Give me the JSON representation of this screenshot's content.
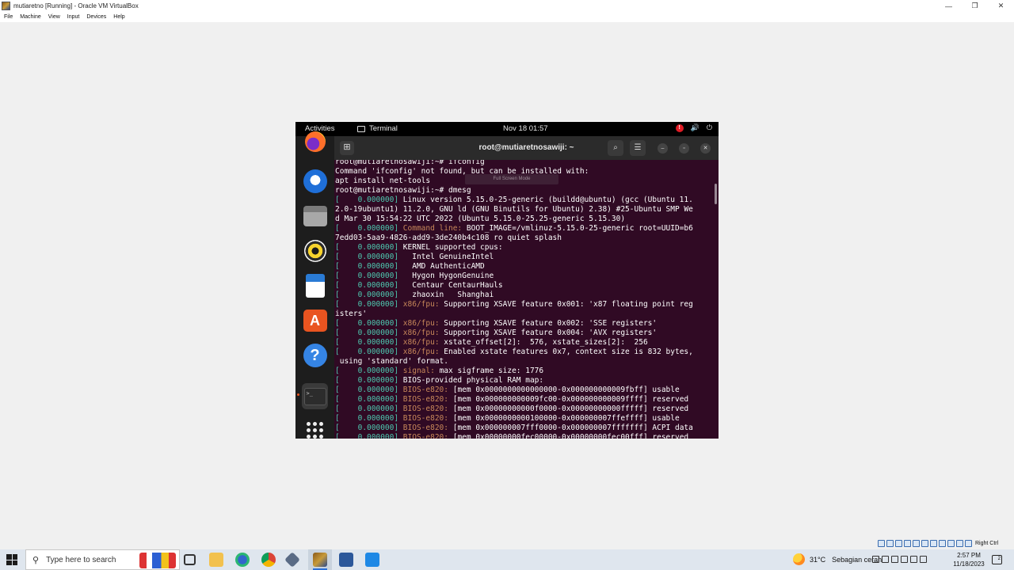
{
  "host": {
    "window_title": "mutiaretno [Running] - Oracle VM VirtualBox",
    "controls": {
      "minimize": "—",
      "restore": "❐",
      "close": "✕"
    },
    "menu": [
      "File",
      "Machine",
      "View",
      "Input",
      "Devices",
      "Help"
    ],
    "host_key": "Right Ctrl"
  },
  "guest": {
    "topbar": {
      "activities": "Activities",
      "app_name": "Terminal",
      "clock": "Nov 18  01:57",
      "alert": "!",
      "volume": "🔊",
      "power": "⏻"
    },
    "terminal": {
      "title": "root@mutiaretnosawiji: ~",
      "newtab": "⊞",
      "search": "⌕",
      "menu": "☰",
      "minimize": "–",
      "maximize": "▫",
      "close": "✕",
      "overlay_hint": "Full Screen Mode",
      "lines": [
        {
          "text": "root@mutiaretnosawiji:~# ifconfig"
        },
        {
          "text": "Command 'ifconfig' not found, but can be installed with:"
        },
        {
          "text": "apt install net-tools"
        },
        {
          "text": "root@mutiaretnosawiji:~# dmesg"
        },
        {
          "ts": "[    0.000000]",
          "text": " Linux version 5.15.0-25-generic (buildd@ubuntu) (gcc (Ubuntu 11."
        },
        {
          "text": "2.0-19ubuntu1) 11.2.0, GNU ld (GNU Binutils for Ubuntu) 2.38) #25-Ubuntu SMP We"
        },
        {
          "text": "d Mar 30 15:54:22 UTC 2022 (Ubuntu 5.15.0-25.25-generic 5.15.30)"
        },
        {
          "ts": "[    0.000000]",
          "sub": " Command line:",
          "text": " BOOT_IMAGE=/vmlinuz-5.15.0-25-generic root=UUID=b6"
        },
        {
          "text": "7edd03-5aa9-4826-add9-3de240b4c108 ro quiet splash"
        },
        {
          "ts": "[    0.000000]",
          "text": " KERNEL supported cpus:"
        },
        {
          "ts": "[    0.000000]",
          "text": "   Intel GenuineIntel"
        },
        {
          "ts": "[    0.000000]",
          "text": "   AMD AuthenticAMD"
        },
        {
          "ts": "[    0.000000]",
          "text": "   Hygon HygonGenuine"
        },
        {
          "ts": "[    0.000000]",
          "text": "   Centaur CentaurHauls"
        },
        {
          "ts": "[    0.000000]",
          "text": "   zhaoxin   Shanghai"
        },
        {
          "ts": "[    0.000000]",
          "sub": " x86/fpu:",
          "text": " Supporting XSAVE feature 0x001: 'x87 floating point reg"
        },
        {
          "text": "isters'"
        },
        {
          "ts": "[    0.000000]",
          "sub": " x86/fpu:",
          "text": " Supporting XSAVE feature 0x002: 'SSE registers'"
        },
        {
          "ts": "[    0.000000]",
          "sub": " x86/fpu:",
          "text": " Supporting XSAVE feature 0x004: 'AVX registers'"
        },
        {
          "ts": "[    0.000000]",
          "sub": " x86/fpu:",
          "text": " xstate_offset[2]:  576, xstate_sizes[2]:  256"
        },
        {
          "ts": "[    0.000000]",
          "sub": " x86/fpu:",
          "text": " Enabled xstate features 0x7, context size is 832 bytes,"
        },
        {
          "text": " using 'standard' format."
        },
        {
          "ts": "[    0.000000]",
          "sub": " signal:",
          "text": " max sigframe size: 1776"
        },
        {
          "ts": "[    0.000000]",
          "text": " BIOS-provided physical RAM map:"
        },
        {
          "ts": "[    0.000000]",
          "sub": " BIOS-e820:",
          "text": " [mem 0x0000000000000000-0x000000000009fbff] usable"
        },
        {
          "ts": "[    0.000000]",
          "sub": " BIOS-e820:",
          "text": " [mem 0x000000000009fc00-0x000000000009ffff] reserved"
        },
        {
          "ts": "[    0.000000]",
          "sub": " BIOS-e820:",
          "text": " [mem 0x00000000000f0000-0x00000000000fffff] reserved"
        },
        {
          "ts": "[    0.000000]",
          "sub": " BIOS-e820:",
          "text": " [mem 0x0000000000100000-0x000000007ffeffff] usable"
        },
        {
          "ts": "[    0.000000]",
          "sub": " BIOS-e820:",
          "text": " [mem 0x000000007fff0000-0x000000007fffffff] ACPI data"
        },
        {
          "ts": "[    0.000000]",
          "sub": " BIOS-e820:",
          "text": " [mem 0x00000000fec00000-0x00000000fec00fff] reserved"
        }
      ]
    }
  },
  "taskbar": {
    "search_placeholder": "Type here to search",
    "weather_temp": "31°C",
    "weather_cond": "Sebagian cerah",
    "time": "2:57 PM",
    "date": "11/18/2023",
    "notifications": "2"
  }
}
